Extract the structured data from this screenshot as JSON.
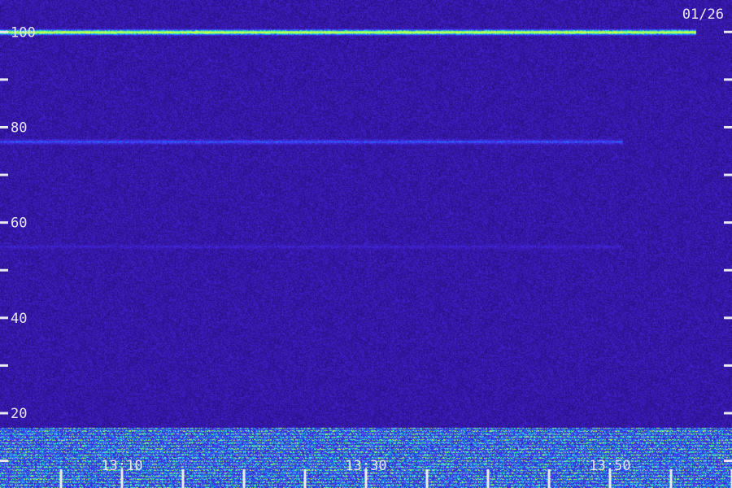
{
  "chart_data": {
    "type": "heatmap",
    "date_label": "01/26",
    "y_ticks": [
      {
        "value": 100,
        "label": "100"
      },
      {
        "value": 80,
        "label": "80"
      },
      {
        "value": 60,
        "label": "60"
      },
      {
        "value": 40,
        "label": "40"
      },
      {
        "value": 20,
        "label": "20"
      }
    ],
    "y_minor_ticks": [
      90,
      70,
      50,
      30,
      10
    ],
    "ylim": [
      4.3,
      106.7
    ],
    "x_labels": [
      {
        "t": 10,
        "label": "13:10"
      },
      {
        "t": 30,
        "label": "13:30"
      },
      {
        "t": 50,
        "label": "13:50"
      }
    ],
    "x_ticks": [
      5,
      10,
      15,
      20,
      25,
      30,
      35,
      40,
      45,
      50,
      55,
      60
    ],
    "xlim": [
      0,
      60
    ],
    "features": [
      {
        "kind": "line",
        "y": 100,
        "t_start": 0,
        "t_end": 57,
        "intensity": 1.0
      },
      {
        "kind": "line",
        "y": 77,
        "t_start": 0,
        "t_end": 51,
        "intensity": 0.45
      },
      {
        "kind": "line",
        "y": 55,
        "t_start": 0,
        "t_end": 51,
        "intensity": 0.25
      },
      {
        "kind": "band",
        "y_low": 4.3,
        "y_high": 17,
        "t_start": 0,
        "t_end": 60,
        "intensity": 0.75
      }
    ],
    "colors": {
      "background": "#1a0f4a",
      "low": "#2a10a0",
      "mid": "#1e6fff",
      "high": "#2dffb0",
      "peak": "#c8ff40",
      "text": "#e8e8f0"
    }
  }
}
